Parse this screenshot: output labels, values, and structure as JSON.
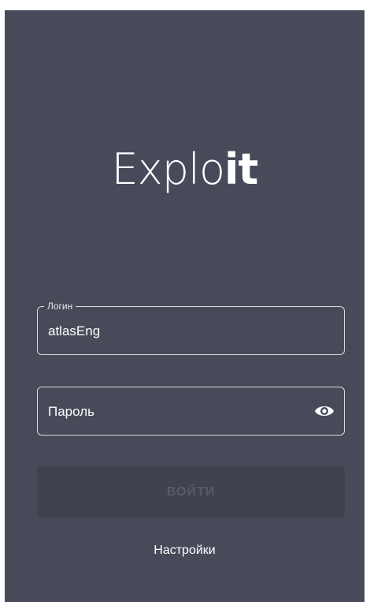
{
  "app": {
    "logo_text_light": "Explo",
    "logo_text_bold": "it",
    "background_color": "#474b59"
  },
  "form": {
    "login": {
      "legend": "Логин",
      "value": "atlasEng"
    },
    "password": {
      "placeholder": "Пароль",
      "toggle_icon": "eye-icon"
    },
    "submit_label": "ВОЙТИ",
    "submit_enabled": false
  },
  "footer": {
    "settings_label": "Настройки"
  }
}
